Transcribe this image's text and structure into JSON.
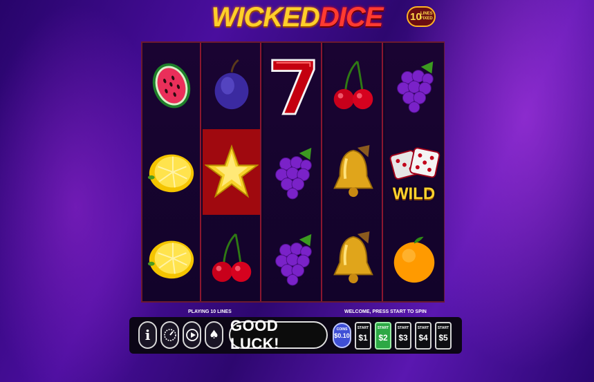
{
  "game": {
    "title_part1": "WICKED",
    "title_part2": "DICE",
    "lines_badge_number": "10",
    "lines_badge_text_1": "LINES",
    "lines_badge_text_2": "FIXED"
  },
  "reels": [
    [
      "watermelon-icon",
      "lemon-icon",
      "lemon-icon"
    ],
    [
      "plum-icon",
      "star-icon",
      "cherry-icon"
    ],
    [
      "seven-icon",
      "grapes-icon",
      "grapes-icon"
    ],
    [
      "cherry-icon",
      "bell-icon",
      "bell-icon"
    ],
    [
      "grapes-icon",
      "wild-dice-icon",
      "orange-icon"
    ]
  ],
  "highlighted_cell": {
    "reel": 2,
    "row": 2
  },
  "wild_label": "WILD",
  "status": {
    "playing_lines": "PLAYING 10 LINES",
    "welcome": "WELCOME, PRESS START TO SPIN"
  },
  "controls": {
    "info_label": "i",
    "good_luck": "GOOD LUCK!",
    "coin_label": "COINS",
    "coin_value": "$0.10",
    "start_label": "START",
    "start_buttons": [
      "$1",
      "$2",
      "$3",
      "$4",
      "$5"
    ],
    "active_start_index": 1
  },
  "colors": {
    "accent_gold": "#ffcf2a",
    "accent_red": "#ff3b30",
    "highlight_red": "#a0090f",
    "active_green": "#2da845"
  }
}
